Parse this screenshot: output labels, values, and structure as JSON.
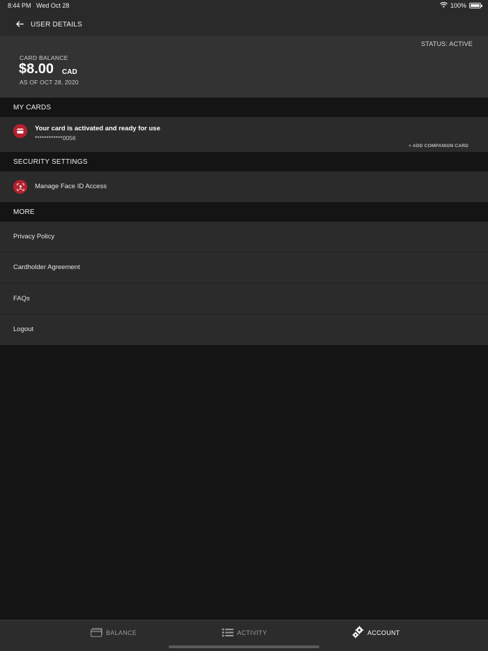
{
  "status_bar": {
    "time": "8:44 PM",
    "date": "Wed Oct 28",
    "battery": "100%"
  },
  "header": {
    "title": "USER DETAILS",
    "back_icon": "back-arrow-icon"
  },
  "balance": {
    "status": "STATUS: ACTIVE",
    "label": "CARD BALANCE",
    "amount": "$8.00",
    "currency": "CAD",
    "as_of": "AS OF OCT 28, 2020"
  },
  "sections": {
    "my_cards": "MY CARDS",
    "security": "SECURITY SETTINGS",
    "more": "MORE"
  },
  "card": {
    "title": "Your card is activated and ready for use",
    "number": "************0056",
    "companion_link": "+ ADD COMPANION CARD",
    "icon": "credit-card-icon"
  },
  "security_items": [
    {
      "label": "Manage Face ID Access",
      "icon": "face-id-icon"
    }
  ],
  "more_items": [
    {
      "label": "Privacy Policy"
    },
    {
      "label": "Cardholder Agreement"
    },
    {
      "label": "FAQs"
    },
    {
      "label": "Logout"
    }
  ],
  "tabs": [
    {
      "label": "BALANCE",
      "icon": "card-icon",
      "active": false
    },
    {
      "label": "ACTIVITY",
      "icon": "list-icon",
      "active": false
    },
    {
      "label": "ACCOUNT",
      "icon": "gears-icon",
      "active": true
    }
  ],
  "colors": {
    "accent": "#b3212e",
    "background": "#141414",
    "panel": "#2b2b2b",
    "balance_panel": "#333333"
  }
}
